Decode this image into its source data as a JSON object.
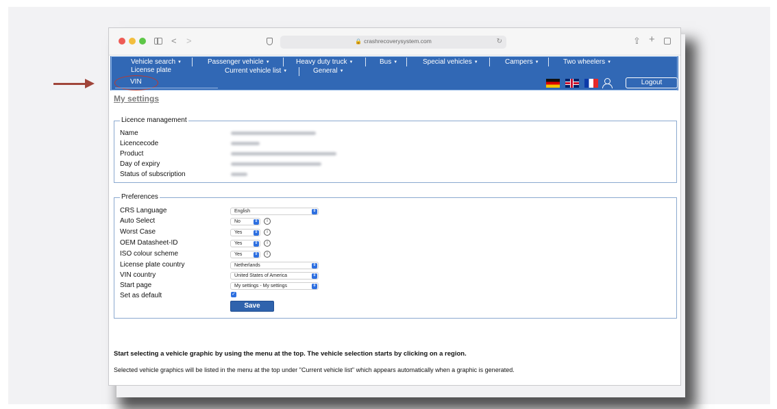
{
  "browser": {
    "url": "crashrecoverysystem.com"
  },
  "nav": {
    "row1": [
      {
        "label": "Vehicle search",
        "caret": "▼"
      },
      {
        "label": "Passenger vehicle",
        "caret": "▼"
      },
      {
        "label": "Heavy duty truck",
        "caret": "▼"
      },
      {
        "label": "Bus",
        "caret": "▼"
      },
      {
        "label": "Special vehicles",
        "caret": "▼"
      },
      {
        "label": "Campers",
        "caret": "▼"
      },
      {
        "label": "Two wheelers",
        "caret": "▼"
      }
    ],
    "row2": [
      {
        "label": "License plate",
        "caret": ""
      },
      {
        "label": "Current vehicle list",
        "caret": "▼"
      },
      {
        "label": "General",
        "caret": "▼"
      }
    ],
    "vin_label": "VIN",
    "logout_label": "Logout"
  },
  "page": {
    "title": "My settings"
  },
  "licence": {
    "legend": "Licence management",
    "rows": [
      "Name",
      "Licencecode",
      "Product",
      "Day of expiry",
      "Status of subscription"
    ]
  },
  "preferences": {
    "legend": "Preferences",
    "crs_language": {
      "label": "CRS Language",
      "value": "English"
    },
    "auto_select": {
      "label": "Auto Select",
      "value": "No"
    },
    "worst_case": {
      "label": "Worst Case",
      "value": "Yes"
    },
    "oem_datasheet": {
      "label": "OEM Datasheet-ID",
      "value": "Yes"
    },
    "iso_colour": {
      "label": "ISO colour scheme",
      "value": "Yes"
    },
    "license_plate_country": {
      "label": "License plate country",
      "value": "Netherlands"
    },
    "vin_country": {
      "label": "VIN country",
      "value": "United States of America"
    },
    "start_page": {
      "label": "Start page",
      "value": "My settings - My settings"
    },
    "set_default": {
      "label": "Set as default",
      "checked": true
    },
    "save_label": "Save",
    "info_glyph": "i",
    "check_glyph": "✓"
  },
  "info": {
    "bold": "Start selecting a vehicle graphic by using the menu at the top. The vehicle selection starts by clicking on a region.",
    "text": "Selected vehicle graphics will be listed in the menu at the top under \"Current vehicle list\" which appears automatically when a graphic is generated."
  },
  "colors": {
    "nav_blue": "#3168b5",
    "annotation": "#a0453a",
    "ellipse": "#c0392b"
  }
}
